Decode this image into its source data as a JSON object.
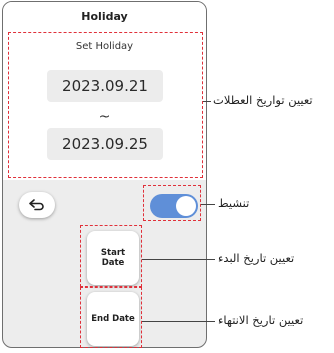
{
  "screen": {
    "title": "Holiday",
    "set_holiday_label": "Set Holiday",
    "start_date_value": "2023.09.21",
    "separator": "~",
    "end_date_value": "2023.09.25",
    "back_icon": "back-arrow-icon",
    "activate_toggle_on": true,
    "toggle_color": "#5f8fd8",
    "start_date_button": "Start Date",
    "end_date_button": "End Date"
  },
  "callouts": {
    "set_holiday_dates": "تعيين تواريخ العطلات",
    "activate": "تنشيط",
    "set_start_date": "تعيين تاريخ البدء",
    "set_end_date": "تعيين تاريخ الانتهاء"
  },
  "annotation_color": "#e0303a"
}
